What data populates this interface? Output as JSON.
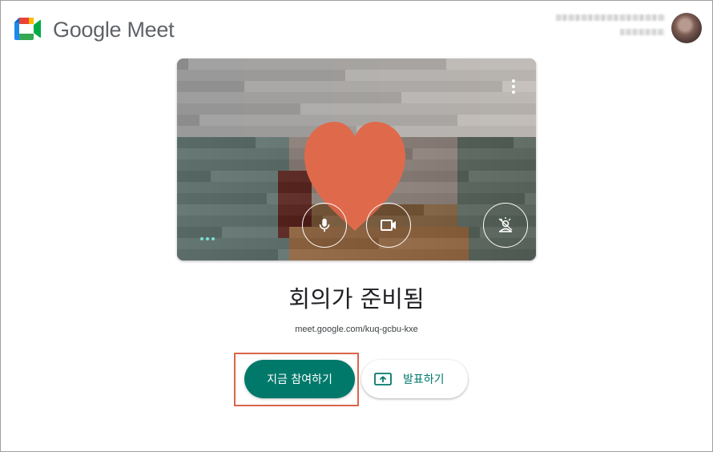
{
  "header": {
    "brand": "Google Meet",
    "account_email_redacted": true
  },
  "preview": {
    "controls": [
      {
        "name": "microphone-icon"
      },
      {
        "name": "camera-icon"
      },
      {
        "name": "visual-effects-icon"
      }
    ],
    "more_options_icon": "more-vert-icon",
    "audio_indicator_icon": "audio-level-dots-icon"
  },
  "main": {
    "title": "회의가 준비됨",
    "meeting_link": "meet.google.com/kuq-gcbu-kxe",
    "join_label": "지금 참여하기",
    "present_label": "발표하기"
  },
  "colors": {
    "accent": "#00796b",
    "highlight": "#d9664a",
    "heart": "#df6a4b"
  }
}
